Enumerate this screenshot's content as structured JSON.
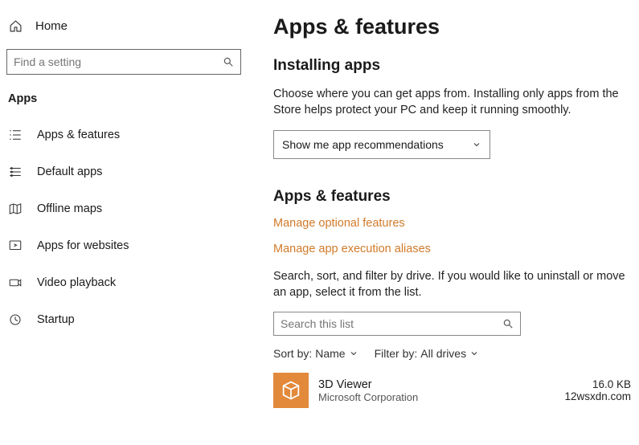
{
  "sidebar": {
    "home": "Home",
    "search_placeholder": "Find a setting",
    "section": "Apps",
    "items": [
      {
        "label": "Apps & features"
      },
      {
        "label": "Default apps"
      },
      {
        "label": "Offline maps"
      },
      {
        "label": "Apps for websites"
      },
      {
        "label": "Video playback"
      },
      {
        "label": "Startup"
      }
    ]
  },
  "main": {
    "title": "Apps & features",
    "installing": {
      "heading": "Installing apps",
      "body": "Choose where you can get apps from. Installing only apps from the Store helps protect your PC and keep it running smoothly.",
      "dropdown": "Show me app recommendations"
    },
    "appsfeat": {
      "heading": "Apps & features",
      "link_optional": "Manage optional features",
      "link_aliases": "Manage app execution aliases",
      "body": "Search, sort, and filter by drive. If you would like to uninstall or move an app, select it from the list.",
      "search_placeholder": "Search this list",
      "sort_label": "Sort by:",
      "sort_value": "Name",
      "filter_label": "Filter by:",
      "filter_value": "All drives"
    },
    "app": {
      "name": "3D Viewer",
      "publisher": "Microsoft Corporation",
      "size": "16.0 KB",
      "date": "12wsxdn.com"
    }
  }
}
